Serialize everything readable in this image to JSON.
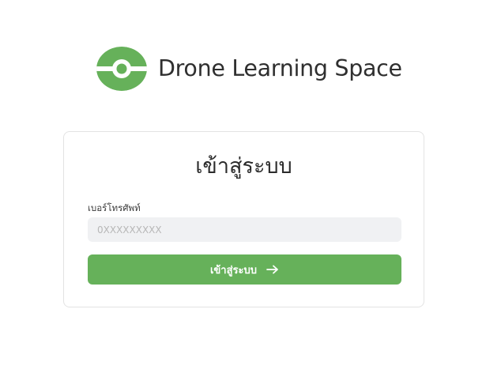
{
  "brand": {
    "name": "Drone Learning Space",
    "logo_icon": "drone-eye-logo-icon",
    "color": "#66b15a"
  },
  "login": {
    "title": "เข้าสู่ระบบ",
    "phone_label": "เบอร์โทรศัพท์",
    "phone_placeholder": "0XXXXXXXXX",
    "phone_value": "",
    "submit_label": "เข้าสู่ระบบ",
    "submit_icon": "arrow-right-icon",
    "button_color": "#66b15a"
  }
}
